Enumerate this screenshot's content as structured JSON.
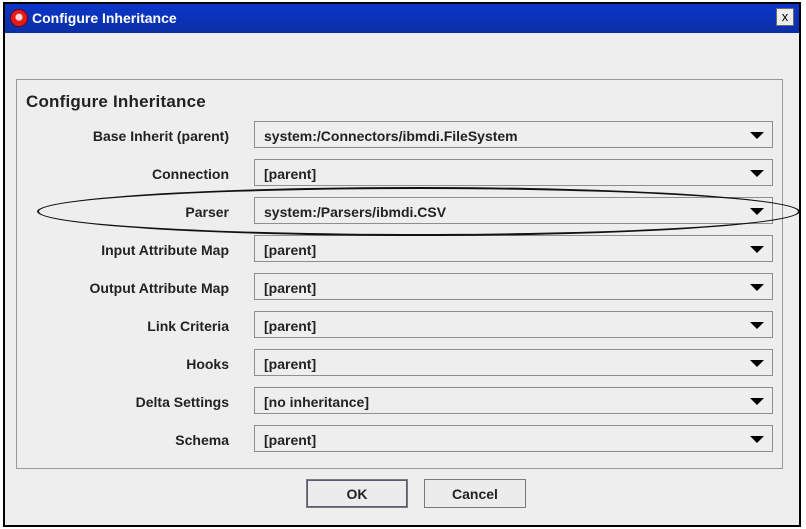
{
  "window": {
    "title": "Configure Inheritance",
    "close_label": "x",
    "icon": "app-icon"
  },
  "group": {
    "title": "Configure Inheritance",
    "rows": [
      {
        "label": "Base Inherit (parent)",
        "value": "system:/Connectors/ibmdi.FileSystem"
      },
      {
        "label": "Connection",
        "value": "[parent]"
      },
      {
        "label": "Parser",
        "value": "system:/Parsers/ibmdi.CSV"
      },
      {
        "label": "Input Attribute Map",
        "value": "[parent]"
      },
      {
        "label": "Output Attribute Map",
        "value": "[parent]"
      },
      {
        "label": "Link Criteria",
        "value": "[parent]"
      },
      {
        "label": "Hooks",
        "value": "[parent]"
      },
      {
        "label": "Delta Settings",
        "value": "[no inheritance]"
      },
      {
        "label": "Schema",
        "value": "[parent]"
      }
    ]
  },
  "buttons": {
    "ok": "OK",
    "cancel": "Cancel"
  }
}
